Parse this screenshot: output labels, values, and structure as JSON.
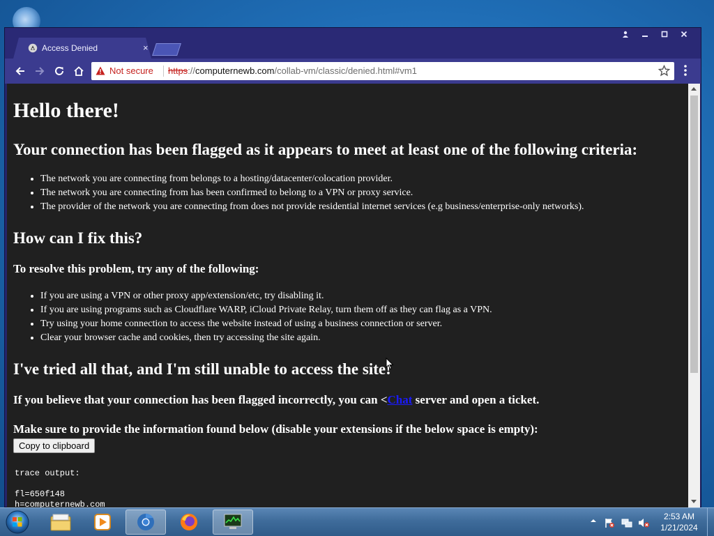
{
  "browser": {
    "tab_title": "Access Denied",
    "tab_close_glyph": "×",
    "security_label": "Not secure",
    "url_scheme": "https",
    "url_sep": "://",
    "url_host": "computernewb.com",
    "url_path": "/collab-vm/classic/denied.html#vm1",
    "icons": {
      "favicon": "shield-icon",
      "back": "back-arrow-icon",
      "forward": "forward-arrow-icon",
      "reload": "reload-icon",
      "home": "home-icon",
      "warning": "warning-icon",
      "bookmark": "star-icon",
      "menu": "kebab-menu-icon",
      "profile": "profile-icon",
      "minimize": "minimize-icon",
      "maximize": "maximize-icon",
      "close": "close-icon"
    }
  },
  "page": {
    "heading": "Hello there!",
    "criteria_heading": "Your connection has been flagged as it appears to meet at least one of the following criteria:",
    "criteria": [
      "The network you are connecting from belongs to a hosting/datacenter/colocation provider.",
      "The network you are connecting from has been confirmed to belong to a VPN or proxy service.",
      "The provider of the network you are connecting from does not provide residential internet services (e.g business/enterprise-only networks)."
    ],
    "fix_heading": "How can I fix this?",
    "resolve_heading": "To resolve this problem, try any of the following:",
    "fixes": [
      "If you are using a VPN or other proxy app/extension/etc, try disabling it.",
      "If you are using programs such as Cloudflare WARP, iCloud Private Relay, turn them off as they can flag as a VPN.",
      "Try using your home connection to access the website instead of using a business connection or server.",
      "Clear your browser cache and cookies, then try accessing the site again."
    ],
    "tried_heading": "I've tried all that, and I'm still unable to access the site!",
    "flagged_prefix": "If you believe that your connection has been flagged incorrectly, you can <",
    "flagged_link": "Chat",
    "flagged_suffix": " server and open a ticket.",
    "info_heading": "Make sure to provide the information found below (disable your extensions if the below space is empty):",
    "copy_button": "Copy to clipboard",
    "trace_label": "trace output:",
    "trace_line_1": "fl=650f148",
    "trace_line_2": "h=computernewb.com"
  },
  "taskbar": {
    "start_icon": "windows-start-icon",
    "items": [
      {
        "name": "file-explorer-icon"
      },
      {
        "name": "media-player-icon"
      },
      {
        "name": "chrome-icon"
      },
      {
        "name": "firefox-icon"
      },
      {
        "name": "task-manager-icon"
      }
    ],
    "tray_icons": [
      "show-hidden-icons-chevron",
      "action-center-flag-icon",
      "network-icon",
      "volume-muted-icon"
    ],
    "time": "2:53 AM",
    "date": "1/21/2024"
  },
  "colors": {
    "window_frame": "#2a2975",
    "toolbar": "#3b3b8f",
    "page_bg": "#202020",
    "not_secure": "#c5221f",
    "link": "#1a1aff"
  }
}
